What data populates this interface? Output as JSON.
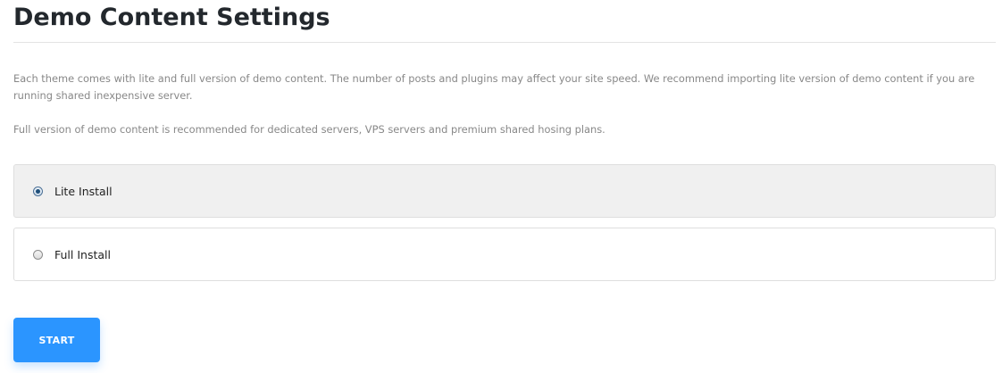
{
  "page": {
    "title": "Demo Content Settings",
    "description_1": "Each theme comes with lite and full version of demo content. The number of posts and plugins may affect your site speed. We recommend importing lite version of demo content if you are running shared inexpensive server.",
    "description_2": "Full version of demo content is recommended for dedicated servers, VPS servers and premium shared hosing plans."
  },
  "options": [
    {
      "label": "Lite Install",
      "selected": true
    },
    {
      "label": "Full Install",
      "selected": false
    }
  ],
  "actions": {
    "start_label": "START"
  },
  "colors": {
    "accent": "#2b95ff",
    "selected_bg": "#f0f0f0",
    "title": "#23282d",
    "muted_text": "#888888"
  }
}
